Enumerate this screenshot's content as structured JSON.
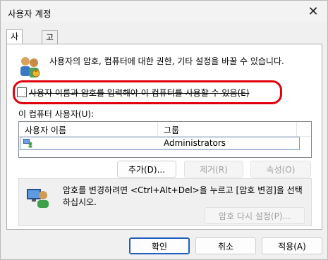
{
  "window": {
    "title": "사용자 계정",
    "close_icon": "close-icon"
  },
  "tabs": [
    {
      "label": "사용자",
      "active": true
    },
    {
      "label": "고급",
      "active": false
    }
  ],
  "users_tab": {
    "description": "사용자의 암호, 컴퓨터에 대한 권한, 기타 설정을 바꿀 수 있습니다.",
    "require_login_checkbox": {
      "label": "사용자 이름과 암호를 입력해야 이 컴퓨터를 사용할 수 있음(E)",
      "checked": false
    },
    "annotation_color": "#e0000e",
    "users_list_label": "이 컴퓨터 사용자(U):",
    "columns": [
      "사용자 이름",
      "그룹"
    ],
    "rows": [
      {
        "name": "",
        "group": "Administrators"
      }
    ],
    "buttons": {
      "add": "추가(D)...",
      "remove": "제거(R)",
      "properties": "속성(O)"
    },
    "password_section": {
      "text": "암호를 변경하려면 <Ctrl+Alt+Del>을 누르고 [암호 변경]을 선택하십시오.",
      "reset_button": "암호 다시 설정(P)..."
    }
  },
  "footer": {
    "ok": "확인",
    "cancel": "취소",
    "apply": "적용(A)"
  }
}
